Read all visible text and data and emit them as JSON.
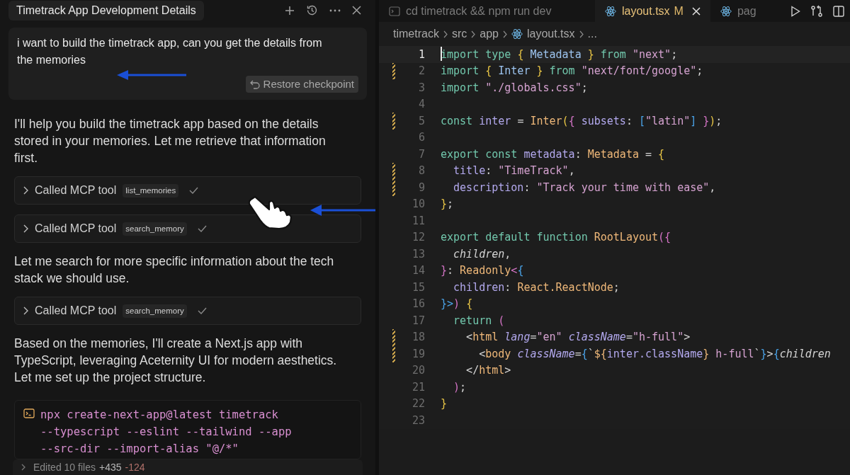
{
  "chat": {
    "title": "Timetrack App Development Details",
    "user_message": {
      "text": "i want to build the timetrack app, can you get the details from the memories",
      "restore_button": "Restore checkpoint"
    },
    "items": [
      {
        "kind": "paragraph",
        "text": "I'll help you build the timetrack app based on the details stored in your memories. Let me retrieve that information first."
      },
      {
        "kind": "tool",
        "label": "Called MCP tool",
        "tool": "list_memories",
        "done": true
      },
      {
        "kind": "tool",
        "label": "Called MCP tool",
        "tool": "search_memory",
        "done": true
      },
      {
        "kind": "paragraph",
        "text": "Let me search for more specific information about the tech stack we should use."
      },
      {
        "kind": "tool",
        "label": "Called MCP tool",
        "tool": "search_memory",
        "done": true
      },
      {
        "kind": "paragraph",
        "text": "Based on the memories, I'll create a Next.js app with TypeScript, leveraging Aceternity UI for modern aesthetics. Let me set up the project structure."
      },
      {
        "kind": "command",
        "lines": [
          "npx create-next-app@latest timetrack",
          "--typescript --eslint --tailwind --app",
          "--src-dir --import-alias \"@/*\""
        ]
      }
    ],
    "edits_bar": {
      "label": "Edited 10 files",
      "added": "+435",
      "removed": "-124"
    }
  },
  "editor": {
    "tabs": [
      {
        "kind": "terminal",
        "label": "cd timetrack && npm run dev",
        "selected": false
      },
      {
        "kind": "react",
        "label": "layout.tsx",
        "badge": "M",
        "selected": true
      },
      {
        "kind": "react",
        "label": "pag",
        "selected": false
      }
    ],
    "breadcrumbs": [
      "timetrack",
      "src",
      "app",
      "layout.tsx",
      "..."
    ],
    "lines": [
      {
        "number": "1",
        "current": true,
        "modified": false,
        "tokens": [
          {
            "kind": "kw",
            "text": "import type "
          },
          {
            "kind": "brace",
            "text": "{ "
          },
          {
            "kind": "type",
            "text": "Metadata "
          },
          {
            "kind": "brace",
            "text": "} "
          },
          {
            "kind": "kw",
            "text": "from "
          },
          {
            "kind": "str",
            "text": "\"next\""
          },
          {
            "kind": "plain",
            "text": ";"
          }
        ]
      },
      {
        "number": "2",
        "current": false,
        "modified": true,
        "tokens": [
          {
            "kind": "kw",
            "text": "import "
          },
          {
            "kind": "brace",
            "text": "{ "
          },
          {
            "kind": "type",
            "text": "Inter "
          },
          {
            "kind": "brace",
            "text": "} "
          },
          {
            "kind": "kw",
            "text": "from "
          },
          {
            "kind": "str",
            "text": "\"next/font/google\""
          },
          {
            "kind": "plain",
            "text": ";"
          }
        ]
      },
      {
        "number": "3",
        "current": false,
        "modified": false,
        "tokens": [
          {
            "kind": "kw",
            "text": "import "
          },
          {
            "kind": "str",
            "text": "\"./globals.css\""
          },
          {
            "kind": "plain",
            "text": ";"
          }
        ]
      },
      {
        "number": "4",
        "current": false,
        "modified": false
      },
      {
        "number": "5",
        "current": false,
        "modified": true,
        "tokens": [
          {
            "kind": "kw",
            "text": "const "
          },
          {
            "kind": "prop",
            "text": "inter "
          },
          {
            "kind": "plain",
            "text": "= "
          },
          {
            "kind": "func",
            "text": "Inter"
          },
          {
            "kind": "brace",
            "text": "("
          },
          {
            "kind": "pink",
            "text": "{ "
          },
          {
            "kind": "prop",
            "text": "subsets"
          },
          {
            "kind": "plain",
            "text": ": "
          },
          {
            "kind": "blue",
            "text": "["
          },
          {
            "kind": "str",
            "text": "\"latin\""
          },
          {
            "kind": "blue",
            "text": "] "
          },
          {
            "kind": "pink",
            "text": "}"
          },
          {
            "kind": "brace",
            "text": ")"
          },
          {
            "kind": "plain",
            "text": ";"
          }
        ]
      },
      {
        "number": "6",
        "current": false,
        "modified": false
      },
      {
        "number": "7",
        "current": false,
        "modified": false,
        "tokens": [
          {
            "kind": "kw",
            "text": "export const "
          },
          {
            "kind": "prop",
            "text": "metadata"
          },
          {
            "kind": "plain",
            "text": ": "
          },
          {
            "kind": "func",
            "text": "Metadata "
          },
          {
            "kind": "plain",
            "text": "= "
          },
          {
            "kind": "brace",
            "text": "{"
          }
        ]
      },
      {
        "number": "8",
        "current": false,
        "modified": true,
        "tokens": [
          {
            "kind": "prop",
            "text": "  title"
          },
          {
            "kind": "plain",
            "text": ": "
          },
          {
            "kind": "str",
            "text": "\"TimeTrack\""
          },
          {
            "kind": "plain",
            "text": ","
          }
        ]
      },
      {
        "number": "9",
        "current": false,
        "modified": true,
        "tokens": [
          {
            "kind": "prop",
            "text": "  description"
          },
          {
            "kind": "plain",
            "text": ": "
          },
          {
            "kind": "str",
            "text": "\"Track your time with ease\""
          },
          {
            "kind": "plain",
            "text": ","
          }
        ]
      },
      {
        "number": "10",
        "current": false,
        "modified": false,
        "tokens": [
          {
            "kind": "brace",
            "text": "}"
          },
          {
            "kind": "plain",
            "text": ";"
          }
        ]
      },
      {
        "number": "11",
        "current": false,
        "modified": false
      },
      {
        "number": "12",
        "current": false,
        "modified": false,
        "tokens": [
          {
            "kind": "kw",
            "text": "export default function "
          },
          {
            "kind": "func",
            "text": "RootLayout"
          },
          {
            "kind": "pink",
            "text": "({"
          }
        ]
      },
      {
        "number": "13",
        "current": false,
        "modified": false,
        "tokens": [
          {
            "kind": "italic",
            "text": "  children"
          },
          {
            "kind": "plain",
            "text": ","
          }
        ]
      },
      {
        "number": "14",
        "current": false,
        "modified": false,
        "tokens": [
          {
            "kind": "pink",
            "text": "}"
          },
          {
            "kind": "plain",
            "text": ": "
          },
          {
            "kind": "func",
            "text": "Readonly"
          },
          {
            "kind": "pink",
            "text": "<"
          },
          {
            "kind": "blue",
            "text": "{"
          }
        ]
      },
      {
        "number": "15",
        "current": false,
        "modified": false,
        "tokens": [
          {
            "kind": "prop",
            "text": "  children"
          },
          {
            "kind": "plain",
            "text": ": "
          },
          {
            "kind": "func",
            "text": "React.ReactNode"
          },
          {
            "kind": "plain",
            "text": ";"
          }
        ]
      },
      {
        "number": "16",
        "current": false,
        "modified": false,
        "tokens": [
          {
            "kind": "blue",
            "text": "}>"
          },
          {
            "kind": "pink",
            "text": ") "
          },
          {
            "kind": "brace",
            "text": "{"
          }
        ]
      },
      {
        "number": "17",
        "current": false,
        "modified": false,
        "tokens": [
          {
            "kind": "kw",
            "text": "  return "
          },
          {
            "kind": "pink",
            "text": "("
          }
        ]
      },
      {
        "number": "18",
        "current": false,
        "modified": true,
        "tokens": [
          {
            "kind": "plain",
            "text": "    <"
          },
          {
            "kind": "func",
            "text": "html "
          },
          {
            "kind": "italicprop",
            "text": "lang"
          },
          {
            "kind": "plain",
            "text": "="
          },
          {
            "kind": "str",
            "text": "\"en\" "
          },
          {
            "kind": "italicprop",
            "text": "className"
          },
          {
            "kind": "plain",
            "text": "="
          },
          {
            "kind": "str",
            "text": "\"h-full\""
          },
          {
            "kind": "plain",
            "text": ">"
          }
        ]
      },
      {
        "number": "19",
        "current": false,
        "modified": true,
        "tokens": [
          {
            "kind": "plain",
            "text": "      <"
          },
          {
            "kind": "func",
            "text": "body "
          },
          {
            "kind": "italicprop",
            "text": "className"
          },
          {
            "kind": "plain",
            "text": "="
          },
          {
            "kind": "blue",
            "text": "{"
          },
          {
            "kind": "plain",
            "text": "`"
          },
          {
            "kind": "func",
            "text": "${"
          },
          {
            "kind": "prop",
            "text": "inter.className"
          },
          {
            "kind": "func",
            "text": "}"
          },
          {
            "kind": "str",
            "text": " h-full"
          },
          {
            "kind": "plain",
            "text": "`"
          },
          {
            "kind": "blue",
            "text": "}"
          },
          {
            "kind": "plain",
            "text": ">"
          },
          {
            "kind": "blue",
            "text": "{"
          },
          {
            "kind": "italic",
            "text": "children"
          }
        ]
      },
      {
        "number": "20",
        "current": false,
        "modified": false,
        "tokens": [
          {
            "kind": "plain",
            "text": "    </"
          },
          {
            "kind": "func",
            "text": "html"
          },
          {
            "kind": "plain",
            "text": ">"
          }
        ]
      },
      {
        "number": "21",
        "current": false,
        "modified": false,
        "tokens": [
          {
            "kind": "pink",
            "text": "  )"
          },
          {
            "kind": "plain",
            "text": ";"
          }
        ]
      },
      {
        "number": "22",
        "current": false,
        "modified": false,
        "tokens": [
          {
            "kind": "brace",
            "text": "}"
          }
        ]
      },
      {
        "number": "23",
        "current": false,
        "modified": false
      }
    ]
  }
}
